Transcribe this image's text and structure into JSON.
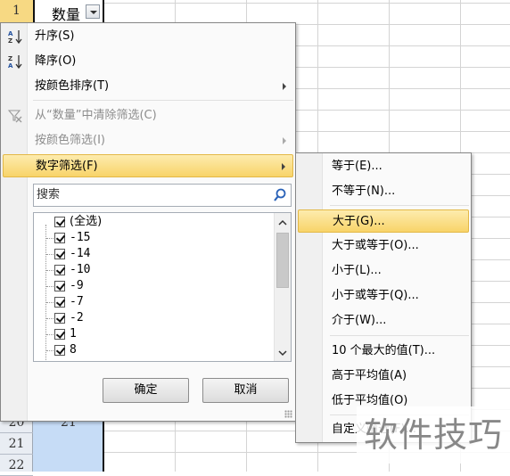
{
  "sheet": {
    "row_headers": [
      "1",
      "20",
      "21",
      "22"
    ],
    "header_cell_label": "数量",
    "cell_value_row20": "21"
  },
  "menu": {
    "sort_asc": "升序(S)",
    "sort_desc": "降序(O)",
    "sort_by_color": "按颜色排序(T)",
    "clear_filter": "从“数量”中清除筛选(C)",
    "filter_by_color": "按颜色筛选(I)",
    "number_filter": "数字筛选(F)",
    "search_placeholder": "搜索",
    "list_items": [
      "(全选)",
      "-15",
      "-14",
      "-10",
      "-9",
      "-7",
      "-2",
      "1",
      "8"
    ],
    "ok_label": "确定",
    "cancel_label": "取消"
  },
  "submenu": {
    "items": [
      "等于(E)...",
      "不等于(N)...",
      "大于(G)...",
      "大于或等于(O)...",
      "小于(L)...",
      "小于或等于(Q)...",
      "介于(W)...",
      "10 个最大的值(T)...",
      "高于平均值(A)",
      "低于平均值(O)",
      "自定义筛选(F)..."
    ],
    "highlighted": "大于(G)..."
  },
  "watermark": "软件技巧",
  "colors": {
    "highlight": "#f8d469",
    "column_fill": "#c6dcf6",
    "row_header_selected": "#f7d983"
  }
}
